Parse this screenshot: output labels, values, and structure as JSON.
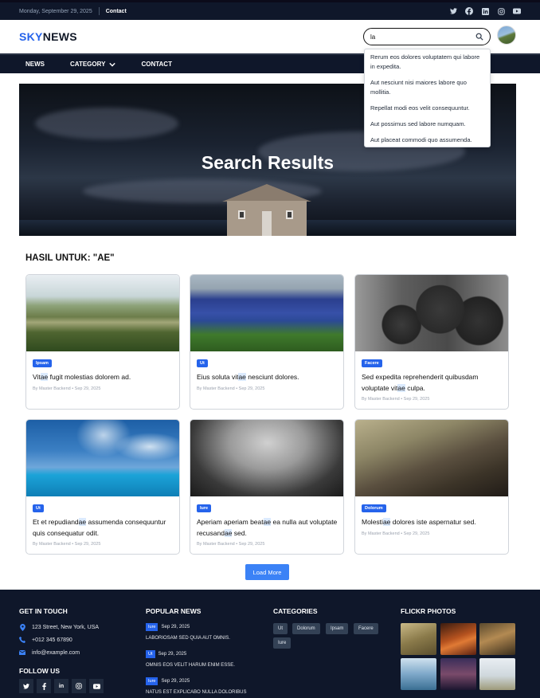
{
  "topbar": {
    "date": "Monday, September 29, 2025",
    "contact": "Contact",
    "social_icons": [
      "twitter-icon",
      "facebook-icon",
      "linkedin-icon",
      "instagram-icon",
      "youtube-icon"
    ]
  },
  "header": {
    "logo_part1": "SKY",
    "logo_part2": "NEWS",
    "search_value": "la",
    "search_icon": "search-icon"
  },
  "nav": {
    "news": "NEWS",
    "category": "CATEGORY",
    "contact": "CONTACT"
  },
  "dropdown": {
    "options": [
      "Rerum eos dolores voluptatem qui labore in expedita.",
      "Aut nesciunt nisi maiores labore quo mollitia.",
      "Repellat modi eos velit consequuntur.",
      "Aut possimus sed labore numquam.",
      "Aut placeat commodi quo assumenda."
    ]
  },
  "hero": {
    "title": "Search Results"
  },
  "results": {
    "title": "HASIL UNTUK: \"AE\"",
    "cards": [
      {
        "badge": "Ipsam",
        "title_parts": [
          "Vit",
          "ae",
          " fugit molestias dolorem ad."
        ],
        "meta": "By Master Backend • Sep 29, 2025"
      },
      {
        "badge": "Ut",
        "title_parts": [
          "Eius soluta vit",
          "ae",
          " nesciunt dolores."
        ],
        "meta": "By Master Backend • Sep 29, 2025"
      },
      {
        "badge": "Facere",
        "title_parts": [
          "Sed expedita reprehenderit quibusdam voluptate vit",
          "ae",
          " culpa."
        ],
        "meta": "By Master Backend • Sep 29, 2025"
      },
      {
        "badge": "Ut",
        "title_parts": [
          "Et et repudiand",
          "ae",
          " assumenda consequuntur quis consequatur odit."
        ],
        "meta": "By Master Backend • Sep 29, 2025"
      },
      {
        "badge": "Iure",
        "title_parts": [
          "Aperiam aperiam beat",
          "ae",
          " ea nulla aut voluptate recusand",
          "ae",
          " sed."
        ],
        "meta": "By Master Backend • Sep 29, 2025"
      },
      {
        "badge": "Dolorum",
        "title_parts": [
          "Molesti",
          "ae",
          " dolores iste aspernatur sed."
        ],
        "meta": "By Master Backend • Sep 29, 2025"
      }
    ],
    "load_more": "Load More"
  },
  "footer": {
    "get_in_touch": {
      "heading": "GET IN TOUCH",
      "address": "123 Street, New York, USA",
      "phone": "+012 345 67890",
      "email": "info@example.com"
    },
    "follow_us": {
      "heading": "FOLLOW US",
      "icons": [
        "twitter-icon",
        "facebook-icon",
        "linkedin-icon",
        "instagram-icon",
        "youtube-icon"
      ]
    },
    "popular_news": {
      "heading": "POPULAR NEWS",
      "items": [
        {
          "badge": "Iure",
          "date": "Sep 29, 2025",
          "title": "LABORIOSAM SED QUIA AUT OMNIS."
        },
        {
          "badge": "Ut",
          "date": "Sep 29, 2025",
          "title": "OMNIS EOS VELIT HARUM ENIM ESSE."
        },
        {
          "badge": "Iure",
          "date": "Sep 29, 2025",
          "title": "NATUS EST EXPLICABO NULLA DOLORIBUS"
        }
      ]
    },
    "categories": {
      "heading": "CATEGORIES",
      "tags": [
        "Ut",
        "Dolorum",
        "Ipsam",
        "Facere",
        "Iure"
      ]
    },
    "flickr": {
      "heading": "FLICKR PHOTOS"
    }
  },
  "colors": {
    "accent": "#2563eb",
    "dark_bg": "#0f172a"
  }
}
